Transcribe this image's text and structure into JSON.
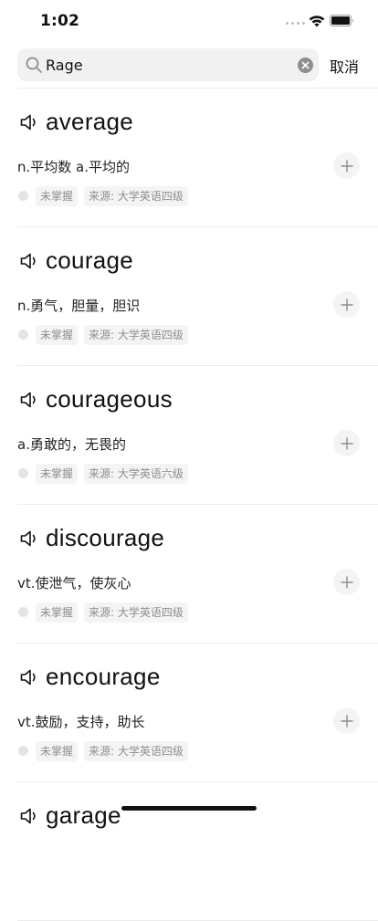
{
  "status_bar": {
    "time": "1:02"
  },
  "search": {
    "value": "Rage",
    "placeholder": "",
    "cancel_label": "取消"
  },
  "words": [
    {
      "word": "average",
      "definition": "n.平均数 a.平均的",
      "status": "未掌握",
      "source": "来源: 大学英语四级"
    },
    {
      "word": "courage",
      "definition": "n.勇气，胆量，胆识",
      "status": "未掌握",
      "source": "来源: 大学英语四级"
    },
    {
      "word": "courageous",
      "definition": "a.勇敢的，无畏的",
      "status": "未掌握",
      "source": "来源: 大学英语六级"
    },
    {
      "word": "discourage",
      "definition": "vt.使泄气，使灰心",
      "status": "未掌握",
      "source": "来源: 大学英语四级"
    },
    {
      "word": "encourage",
      "definition": "vt.鼓励，支持，助长",
      "status": "未掌握",
      "source": "来源: 大学英语四级"
    },
    {
      "word": "garage",
      "definition": "",
      "status": "",
      "source": ""
    }
  ],
  "icons": {
    "search": "search-icon",
    "clear": "clear-icon",
    "speaker": "speaker-icon",
    "add": "plus-icon",
    "wifi": "wifi-icon",
    "battery": "battery-icon",
    "signal": "signal-icon"
  },
  "colors": {
    "text": "#111111",
    "tag_bg": "#f4f4f5",
    "tag_text": "#8e8e93",
    "search_bg": "#f1f1f2",
    "divider": "#ececec"
  }
}
